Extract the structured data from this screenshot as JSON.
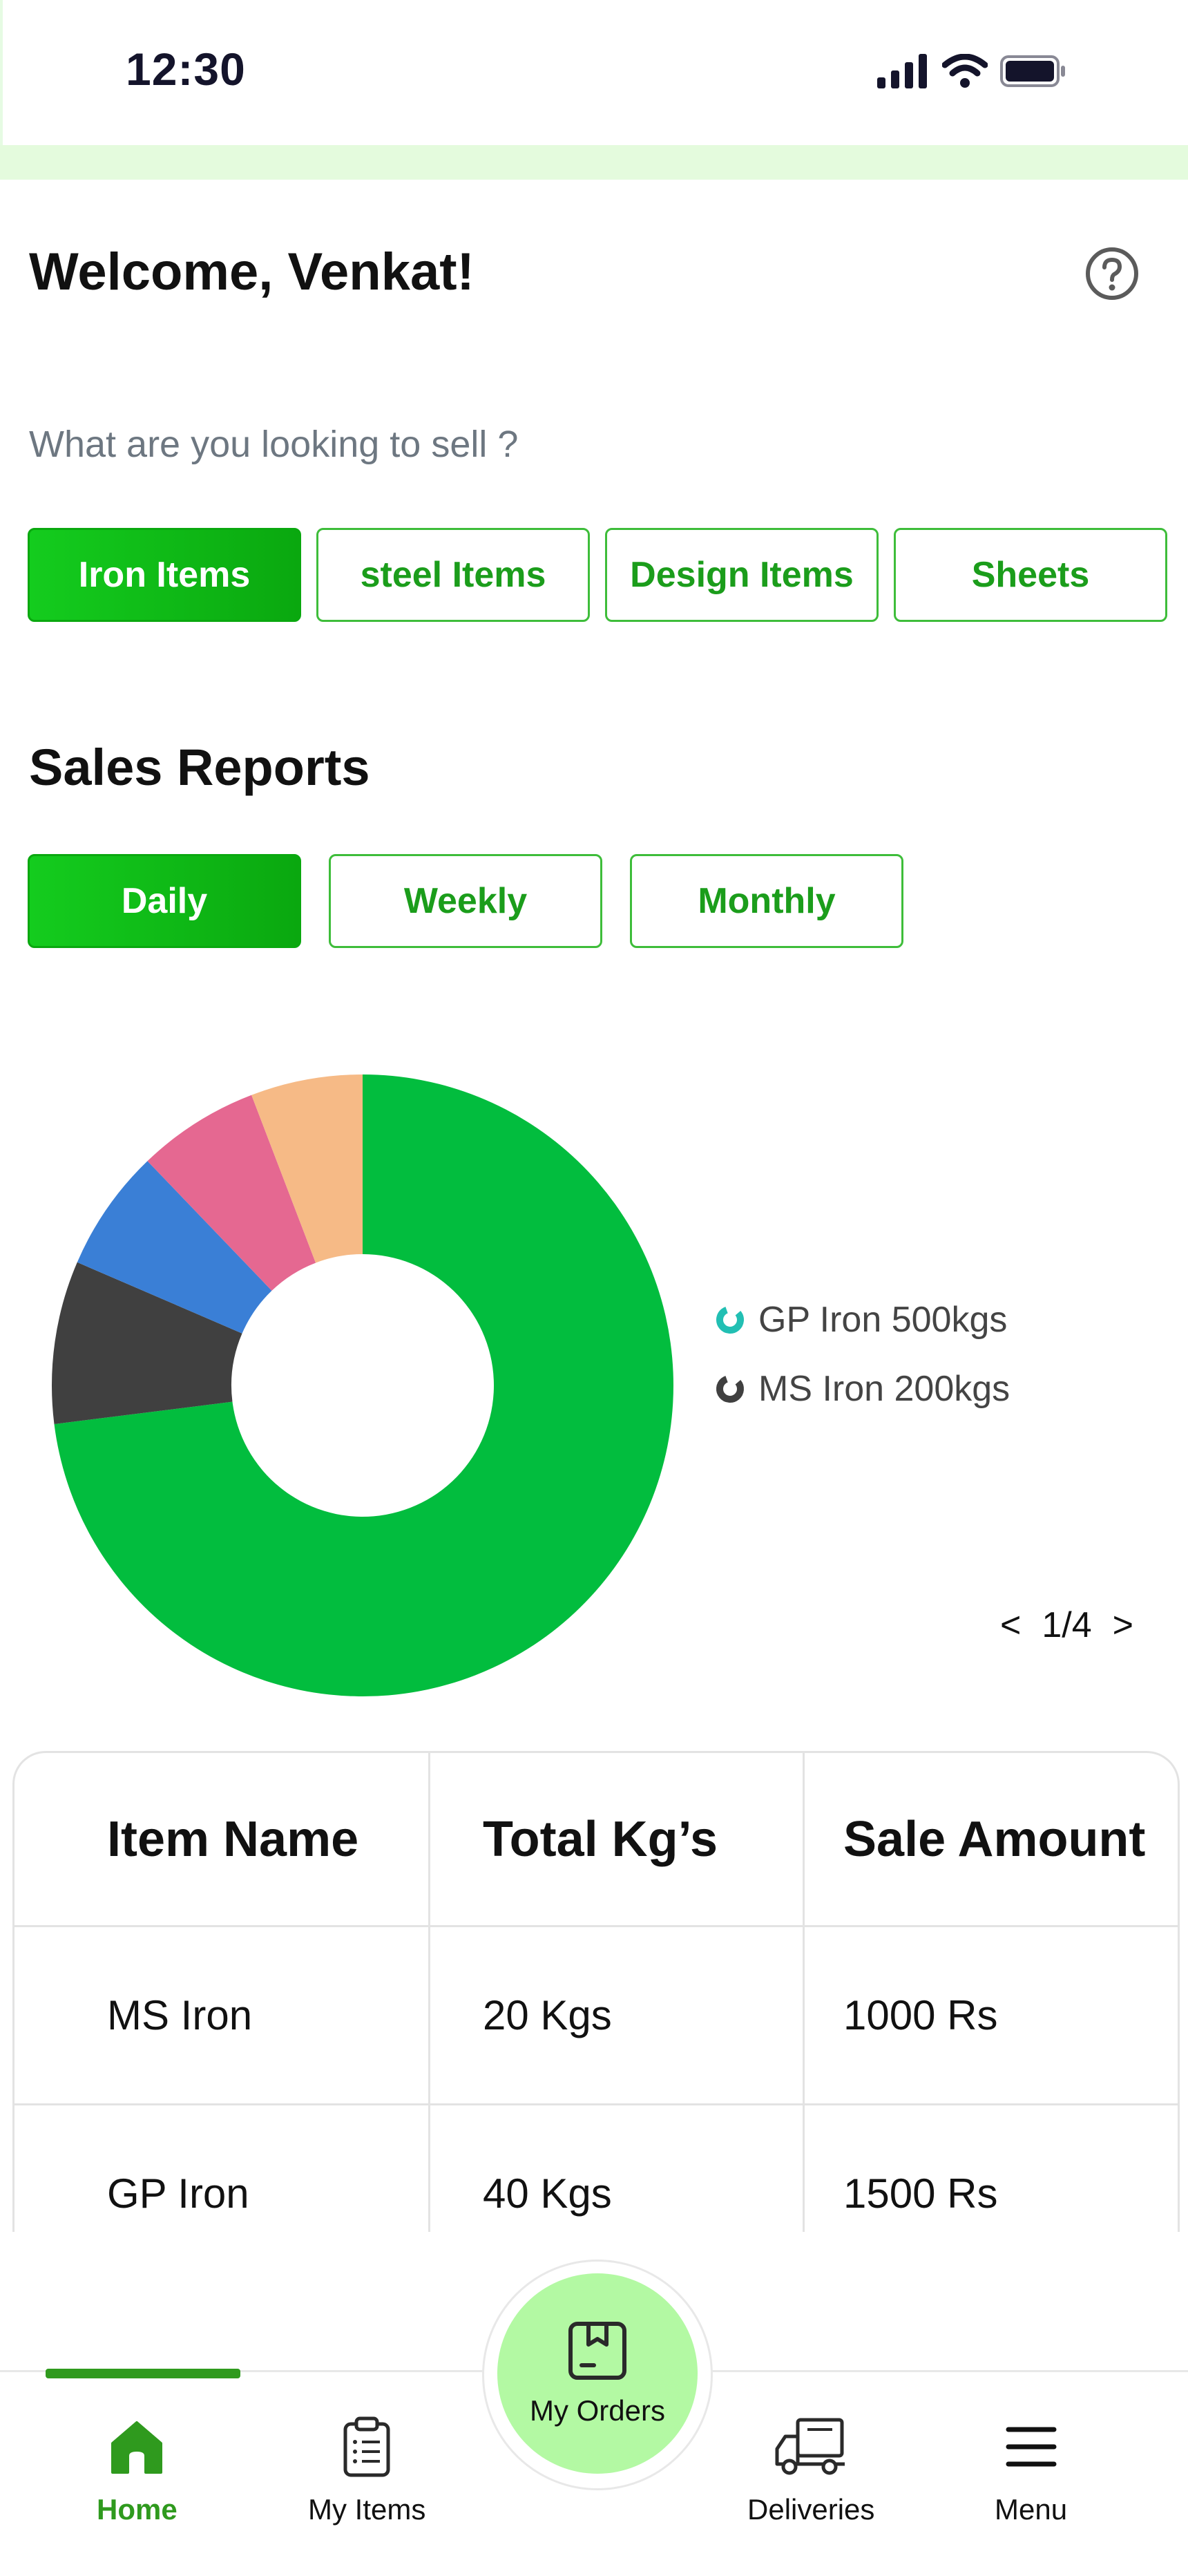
{
  "status_bar": {
    "time": "12:30"
  },
  "header": {
    "welcome": "Welcome, Venkat!"
  },
  "sell": {
    "question": "What are you looking to sell ?",
    "categories": [
      {
        "label": "Iron Items",
        "active": true
      },
      {
        "label": "steel Items",
        "active": false
      },
      {
        "label": "Design Items",
        "active": false
      },
      {
        "label": "Sheets",
        "active": false
      }
    ]
  },
  "sales_reports": {
    "title": "Sales Reports",
    "ranges": [
      {
        "label": "Daily",
        "active": true
      },
      {
        "label": "Weekly",
        "active": false
      },
      {
        "label": "Monthly",
        "active": false
      }
    ],
    "pager": {
      "prev": "<",
      "page": "1/4",
      "next": ">"
    }
  },
  "chart_data": {
    "type": "pie",
    "donut": true,
    "slices": [
      {
        "value": 69,
        "color": "#02bd3e"
      },
      {
        "value": 8,
        "color": "#404040"
      },
      {
        "value": 6,
        "color": "#3a7fd6"
      },
      {
        "value": 6,
        "color": "#e56891"
      },
      {
        "value": 5.5,
        "color": "#f6ba86"
      }
    ],
    "legend": [
      {
        "label": "GP Iron 500kgs",
        "color": "#22bfb3"
      },
      {
        "label": "MS Iron 200kgs",
        "color": "#404040"
      }
    ]
  },
  "table": {
    "headers": [
      "Item Name",
      "Total Kg’s",
      "Sale Amount"
    ],
    "rows": [
      [
        "MS Iron",
        "20 Kgs",
        "1000 Rs"
      ],
      [
        "GP Iron",
        "40 Kgs",
        "1500 Rs"
      ]
    ]
  },
  "nav": {
    "home": "Home",
    "my_items": "My Items",
    "my_orders": "My Orders",
    "deliveries": "Deliveries",
    "menu": "Menu"
  },
  "colors": {
    "accent": "#0aa80f",
    "nav_active": "#2f9a1e",
    "fab": "#b3f9a3"
  }
}
